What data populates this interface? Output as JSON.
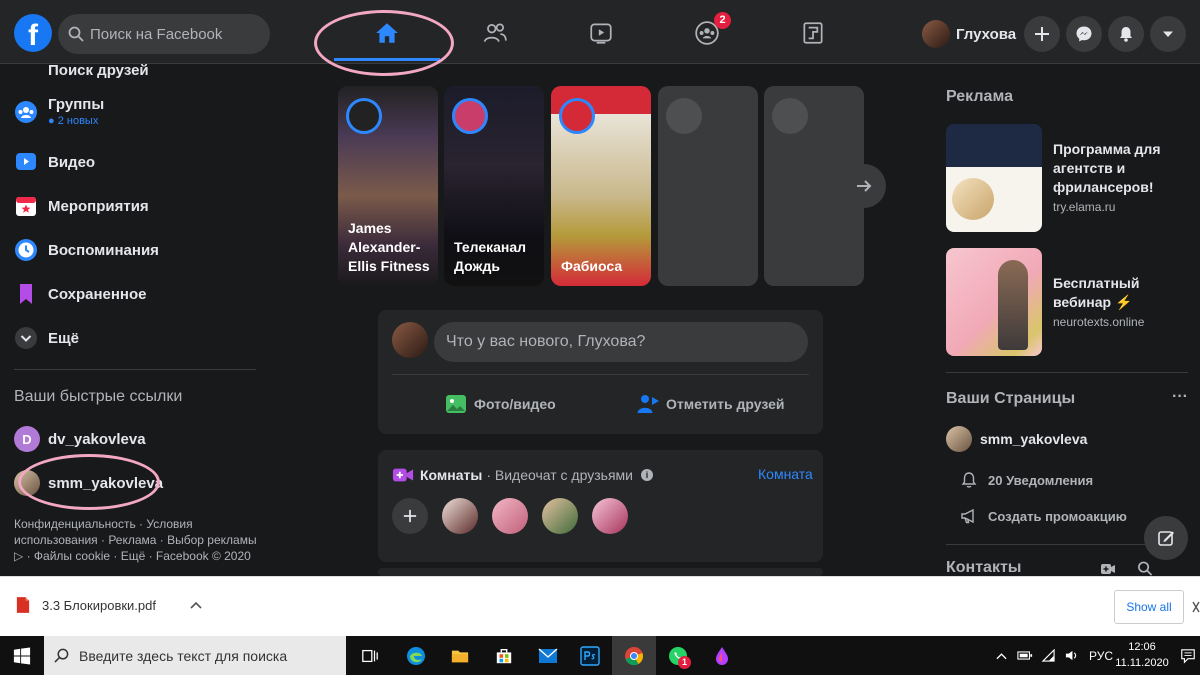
{
  "header": {
    "logo_letter": "f",
    "search_placeholder": "Поиск на Facebook",
    "groups_badge": "2",
    "profile_name": "Глухова"
  },
  "sidebar": {
    "items": [
      {
        "label": "Поиск друзей"
      },
      {
        "label": "Группы",
        "note": "● 2 новых"
      },
      {
        "label": "Видео"
      },
      {
        "label": "Мероприятия"
      },
      {
        "label": "Воспоминания"
      },
      {
        "label": "Сохраненное"
      },
      {
        "label": "Ещё"
      }
    ],
    "shortcuts_title": "Ваши быстрые ссылки",
    "shortcuts": [
      {
        "initial": "D",
        "label": "dv_yakovleva"
      },
      {
        "label": "smm_yakovleva"
      }
    ],
    "footer": "Конфиденциальность · Условия использования · Реклама · Выбор рекламы ▷ · Файлы cookie · Ещё · Facebook © 2020"
  },
  "stories": [
    {
      "name": "James Alexander-Ellis Fitness"
    },
    {
      "name": "Телеканал Дождь"
    },
    {
      "name": "Фабиоса"
    }
  ],
  "composer": {
    "placeholder": "Что у вас нового, Глухова?",
    "photo_label": "Фото/видео",
    "tag_label": "Отметить друзей"
  },
  "rooms": {
    "title": "Комнаты",
    "subtitle": "· Видеочат с друзьями",
    "create_label": "Комната"
  },
  "right": {
    "ads_title": "Реклама",
    "ads": [
      {
        "title": "Программа для агентств и фрилансеров!",
        "domain": "try.elama.ru"
      },
      {
        "title": "Бесплатный вебинар ⚡",
        "domain": "neurotexts.online"
      }
    ],
    "pages_title": "Ваши Страницы",
    "pages_more": "···",
    "page_name": "smm_yakovleva",
    "notifications": "20 Уведомления",
    "promo": "Создать промоакцию",
    "contacts_title": "Контакты"
  },
  "download": {
    "file": "3.3 Блокировки.pdf",
    "show_all": "Show all"
  },
  "taskbar": {
    "search_placeholder": "Введите здесь текст для поиска",
    "lang": "РУС",
    "time": "12:06",
    "date": "11.11.2020",
    "whatsapp_badge": "1"
  },
  "colors": {
    "accent": "#2d88ff",
    "brand": "#1877f2",
    "highlight_circle": "#f2a7c3",
    "badge": "#e41e3f"
  }
}
